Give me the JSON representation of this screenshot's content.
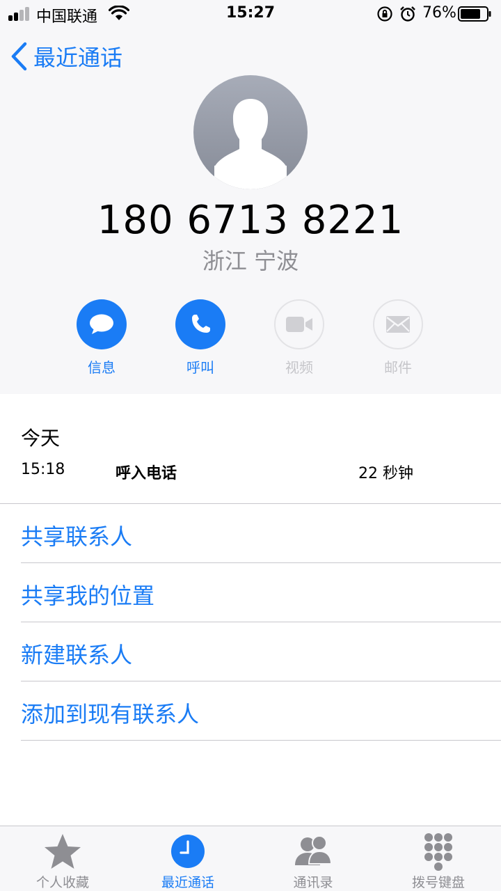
{
  "status_bar": {
    "carrier": "中国联通",
    "time": "15:27",
    "battery_percent": "76%"
  },
  "nav": {
    "back_label": "最近通话"
  },
  "contact": {
    "phone_number": "180 6713 8221",
    "location": "浙江 宁波"
  },
  "actions": [
    {
      "label": "信息",
      "icon": "message-bubble-icon",
      "enabled": true
    },
    {
      "label": "呼叫",
      "icon": "phone-icon",
      "enabled": true
    },
    {
      "label": "视频",
      "icon": "video-camera-icon",
      "enabled": false
    },
    {
      "label": "邮件",
      "icon": "envelope-icon",
      "enabled": false
    }
  ],
  "history": {
    "date": "今天",
    "time": "15:18",
    "type": "呼入电话",
    "duration": "22 秒钟"
  },
  "options": [
    {
      "label": "共享联系人"
    },
    {
      "label": "共享我的位置"
    },
    {
      "label": "新建联系人"
    },
    {
      "label": "添加到现有联系人"
    }
  ],
  "tabs": [
    {
      "label": "个人收藏",
      "icon": "star-icon",
      "active": false
    },
    {
      "label": "最近通话",
      "icon": "clock-icon",
      "active": true
    },
    {
      "label": "通讯录",
      "icon": "contacts-icon",
      "active": false
    },
    {
      "label": "拨号键盘",
      "icon": "keypad-icon",
      "active": false
    }
  ],
  "colors": {
    "accent": "#1a7cf5",
    "header_background": "#f7f7f9",
    "secondary_text": "#8e8e93",
    "disabled": "#c5c5c9"
  }
}
